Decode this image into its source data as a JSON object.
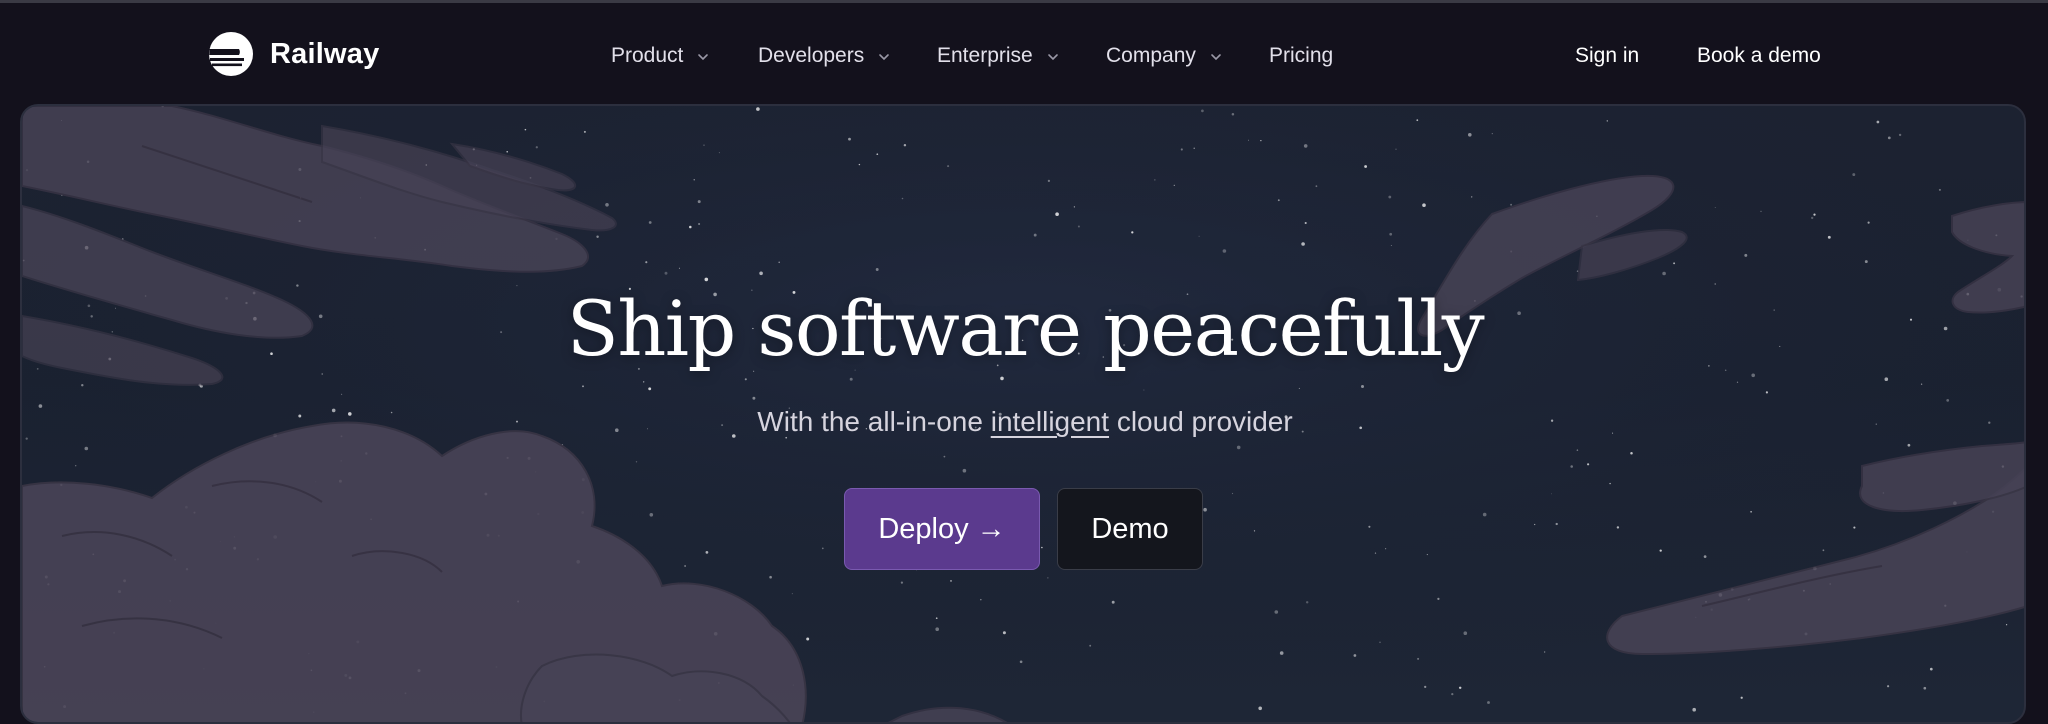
{
  "brand": {
    "name": "Railway"
  },
  "nav": {
    "items": [
      {
        "label": "Product",
        "has_dropdown": true
      },
      {
        "label": "Developers",
        "has_dropdown": true
      },
      {
        "label": "Enterprise",
        "has_dropdown": true
      },
      {
        "label": "Company",
        "has_dropdown": true
      },
      {
        "label": "Pricing",
        "has_dropdown": false
      }
    ],
    "sign_in": "Sign in",
    "book_demo": "Book a demo"
  },
  "hero": {
    "headline": "Ship software peacefully",
    "sub_before": "With the all-in-one",
    "sub_link": "intelligent",
    "sub_after": "cloud provider",
    "deploy_label": "Deploy →",
    "demo_label": "Demo"
  },
  "colors": {
    "page_bg": "#13111c",
    "deploy_bg": "#5b3a8e",
    "demo_bg": "#14161d",
    "cloud": "#4a4558"
  },
  "icons": [
    "railway-logo-icon",
    "chevron-down-icon"
  ]
}
